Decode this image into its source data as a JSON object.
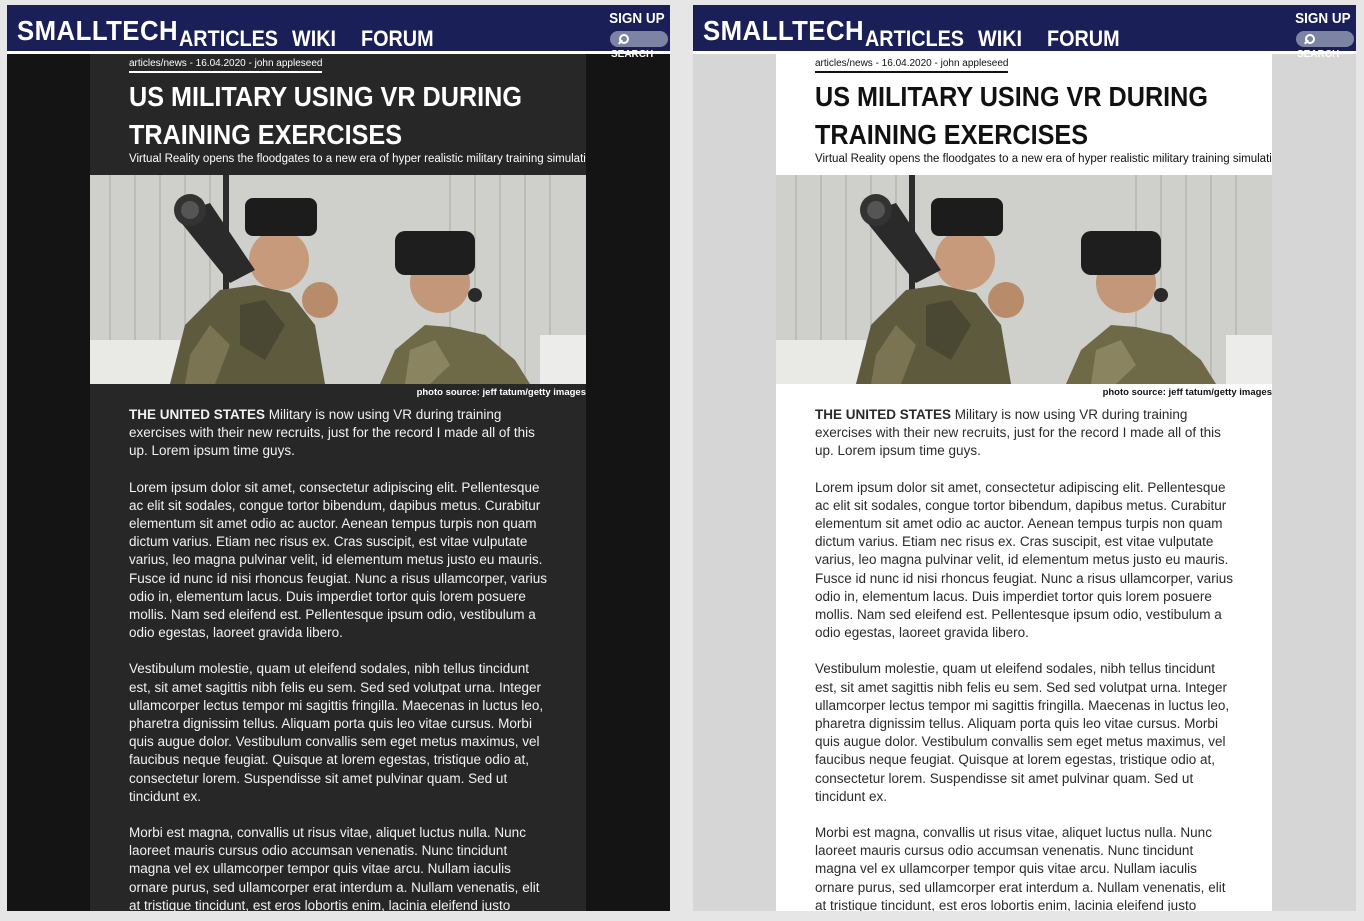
{
  "site": {
    "logo": "SMALLTECH",
    "nav": [
      "ARTICLES",
      "WIKI",
      "FORUM"
    ],
    "signup": "SIGN UP",
    "search": "SEARCH"
  },
  "article": {
    "meta": "articles/news - 16.04.2020 - john appleseed",
    "title_line1": "US MILITARY USING VR DURING",
    "title_line2": "TRAINING EXERCISES",
    "subtitle": "Virtual Reality opens the floodgates to a new era of hyper realistic military training simulations.",
    "caption": "photo source: jeff tatum/getty images",
    "lead": "THE UNITED STATES",
    "lead_rest": " Military is now using VR during training exercises with their new recruits, just for the record I made all of this up. Lorem ipsum time guys.",
    "para1": "Lorem ipsum dolor sit amet, consectetur adipiscing elit. Pellentesque ac elit sit sodales, congue tortor bibendum, dapibus metus. Curabitur elementum sit amet odio ac auctor. Aenean tempus turpis non quam dictum varius. Etiam nec risus ex. Cras suscipit, est vitae vulputate varius, leo magna pulvinar velit, id elementum metus justo eu mauris. Fusce id nunc id nisi rhoncus feugiat. Nunc a risus ullamcorper, varius odio in, elementum lacus. Duis imperdiet tortor quis lorem posuere mollis. Nam sed eleifend est. Pellentesque ipsum odio, vestibulum a odio egestas, laoreet gravida libero.",
    "para2": "Vestibulum molestie, quam ut eleifend sodales, nibh tellus tincidunt est, sit amet sagittis nibh felis eu sem. Sed sed volutpat urna. Integer ullamcorper lectus tempor mi sagittis fringilla. Maecenas in luctus leo, pharetra dignissim tellus. Aliquam porta quis leo vitae cursus. Morbi quis augue dolor. Vestibulum convallis sem eget metus maximus, vel faucibus neque feugiat. Quisque at lorem egestas, tristique odio at, consectetur lorem. Suspendisse sit amet pulvinar quam. Sed ut tincidunt ex.",
    "para3": "Morbi est magna, convallis ut risus vitae, aliquet luctus nulla. Nunc laoreet mauris cursus odio accumsan venenatis. Nunc tincidunt magna vel ex ullamcorper tempor quis vitae arcu. Nullam iaculis ornare purus, sed ullamcorper erat interdum a. Nullam venenatis, elit at tristique tincidunt, est eros lobortis enim, lacinia eleifend justo"
  },
  "colors": {
    "header": "#1a1f57",
    "dark_background": "#141414",
    "dark_article": "#272727",
    "light_background": "#d6d6d6",
    "light_article": "#ffffff"
  }
}
